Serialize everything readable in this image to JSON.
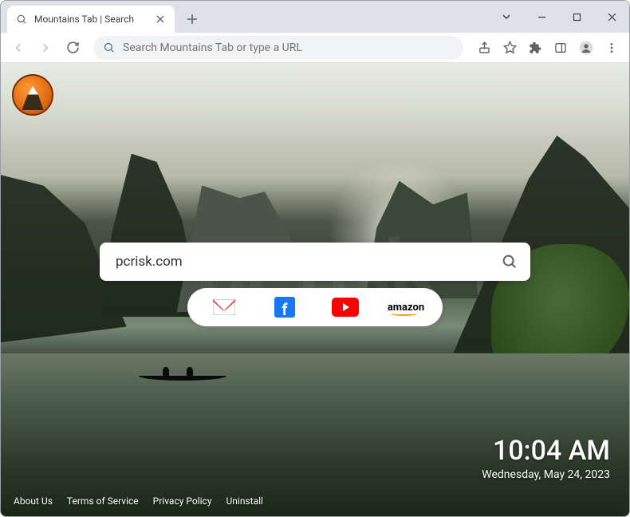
{
  "browser": {
    "tab": {
      "title": "Mountains Tab | Search"
    },
    "omnibox": {
      "placeholder": "Search Mountains Tab or type a URL"
    }
  },
  "page": {
    "search": {
      "value": "pcrisk.com"
    },
    "shortcuts": {
      "gmail": "Gmail",
      "facebook": "f",
      "youtube": "YouTube",
      "amazon": "amazon"
    },
    "clock": {
      "time": "10:04 AM",
      "date": "Wednesday, May 24, 2023"
    },
    "footer": {
      "about": "About Us",
      "terms": "Terms of Service",
      "privacy": "Privacy Policy",
      "uninstall": "Uninstall"
    }
  }
}
